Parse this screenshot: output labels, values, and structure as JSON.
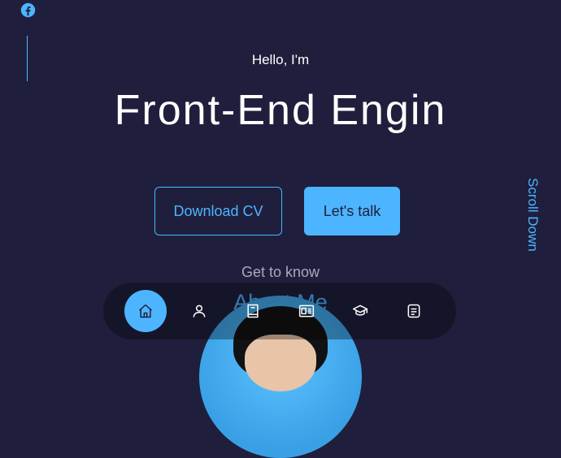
{
  "hero": {
    "greeting": "Hello, I'm",
    "headline": "Front-End Engin"
  },
  "actions": {
    "download_cv": "Download CV",
    "lets_talk": "Let's talk"
  },
  "scroll": {
    "label": "Scroll Down"
  },
  "about": {
    "subtitle": "Get to know",
    "title": "About Me"
  },
  "social": {
    "icons": [
      "facebook-icon"
    ]
  },
  "nav": {
    "items": [
      {
        "icon": "home-icon",
        "active": true
      },
      {
        "icon": "user-icon",
        "active": false
      },
      {
        "icon": "book-icon",
        "active": false
      },
      {
        "icon": "portfolio-icon",
        "active": false
      },
      {
        "icon": "graduation-cap-icon",
        "active": false
      },
      {
        "icon": "message-icon",
        "active": false
      }
    ]
  },
  "colors": {
    "background": "#1f1f3d",
    "accent": "#4db5ff",
    "text": "#ffffff",
    "muted": "#a9a9bc",
    "nav_background": "rgba(0,0,0,0.32)"
  }
}
